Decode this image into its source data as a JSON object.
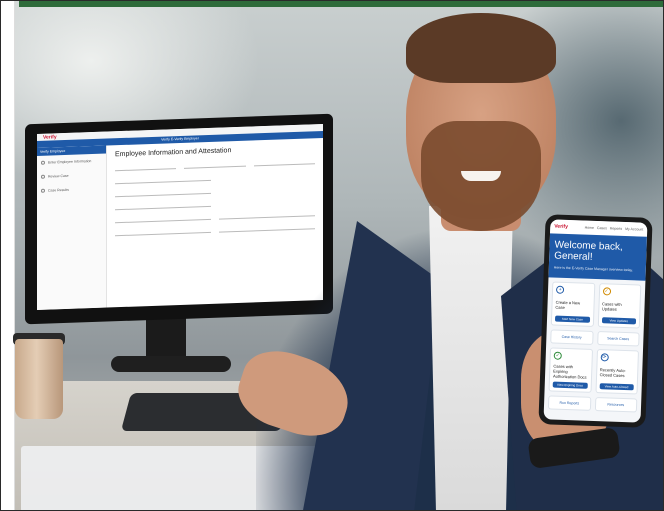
{
  "desktop": {
    "logo": "Verify",
    "banner": "Verify E-Verify Employer",
    "sidebar_header": "Verify Employee",
    "steps": [
      "Enter Employee Information",
      "Review Case",
      "Case Results"
    ],
    "page_title": "Employee Information and Attestation"
  },
  "phone": {
    "logo": "Verify",
    "nav": [
      "Home",
      "Cases",
      "Reports",
      "My Account"
    ],
    "welcome": "Welcome back, General!",
    "subtitle": "Here is the E-Verify Case Manager overview today.",
    "cards": [
      {
        "icon": "+",
        "title": "Create a New Case",
        "button": "Start New Case"
      },
      {
        "icon": "✓",
        "title": "Cases with Updates",
        "button": "View Updates"
      },
      {
        "icon": "✓",
        "title": "Cases with Expiring Authorization Docs",
        "button": "View Expiring Docs"
      },
      {
        "icon": "⟳",
        "title": "Recently Auto-Closed Cases",
        "button": "View Auto-Closed"
      }
    ],
    "links": [
      "Case History",
      "Search Cases",
      "Run Reports",
      "Resources"
    ]
  },
  "colors": {
    "brand_blue": "#1f5aa8",
    "brand_red": "#c8102e",
    "top_accent": "#2e6b3a"
  }
}
